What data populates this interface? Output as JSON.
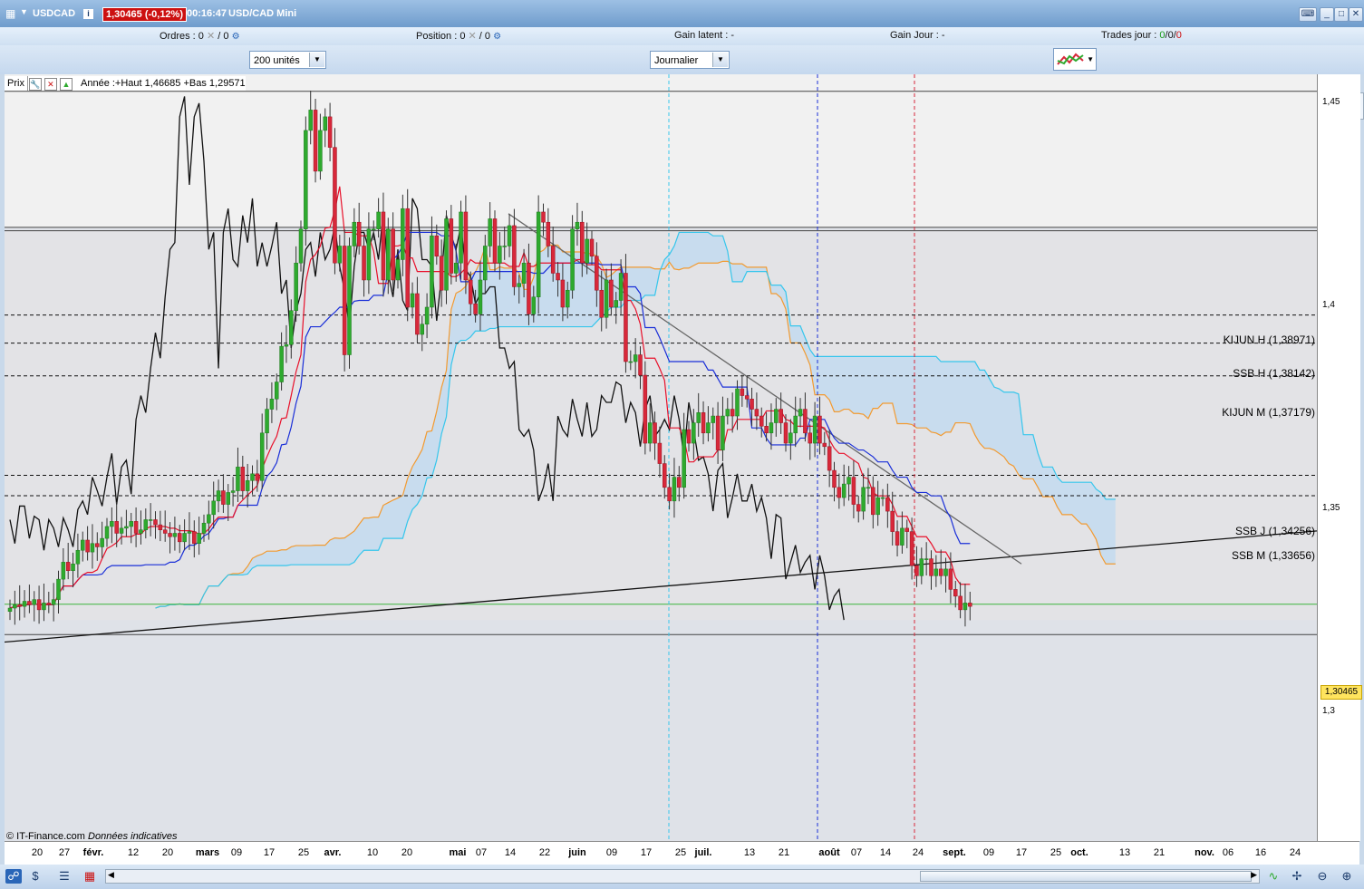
{
  "titlebar": {
    "symbol": "USDCAD",
    "price": "1,30465 (-0,12%)",
    "time": "00:16:47",
    "instrument": "USD/CAD Mini"
  },
  "infobar": {
    "orders_label": "Ordres :",
    "orders_value": "0",
    "orders_value2": "0",
    "position_label": "Position :",
    "position_value": "0",
    "position_value2": "0",
    "gain_latent_label": "Gain latent :",
    "gain_latent_value": "-",
    "gain_jour_label": "Gain Jour :",
    "gain_jour_value": "-",
    "trades_label": "Trades jour :",
    "trades_a": "0",
    "trades_b": "0",
    "trades_c": "0",
    "sep": "/"
  },
  "toolbar": {
    "units_select": "200 unités",
    "period_select": "Journalier"
  },
  "legend": {
    "prix": "Prix",
    "text": "Année :+Haut 1,46685 +Bas 1,29571"
  },
  "levels": [
    {
      "label": "KIJUN H (1,38971)",
      "value": 1.38971
    },
    {
      "label": "SSB H (1,38142)",
      "value": 1.38142
    },
    {
      "label": "KIJUN M (1,37179)",
      "value": 1.37179
    },
    {
      "label": "SSB J (1,34256)",
      "value": 1.34256
    },
    {
      "label": "SSB M (1,33656)",
      "value": 1.33656
    }
  ],
  "y_ticks": [
    "1,45",
    "1,4",
    "1,35",
    "1,3"
  ],
  "current_price": "1,30465",
  "x_ticks": [
    {
      "t": "20",
      "b": false
    },
    {
      "t": "27",
      "b": false
    },
    {
      "t": "févr.",
      "b": true
    },
    {
      "t": "12",
      "b": false
    },
    {
      "t": "20",
      "b": false
    },
    {
      "t": "mars",
      "b": true
    },
    {
      "t": "09",
      "b": false
    },
    {
      "t": "17",
      "b": false
    },
    {
      "t": "25",
      "b": false
    },
    {
      "t": "avr.",
      "b": true
    },
    {
      "t": "10",
      "b": false
    },
    {
      "t": "20",
      "b": false
    },
    {
      "t": "mai",
      "b": true
    },
    {
      "t": "07",
      "b": false
    },
    {
      "t": "14",
      "b": false
    },
    {
      "t": "22",
      "b": false
    },
    {
      "t": "juin",
      "b": true
    },
    {
      "t": "09",
      "b": false
    },
    {
      "t": "17",
      "b": false
    },
    {
      "t": "25",
      "b": false
    },
    {
      "t": "juil.",
      "b": true
    },
    {
      "t": "13",
      "b": false
    },
    {
      "t": "21",
      "b": false
    },
    {
      "t": "août",
      "b": true
    },
    {
      "t": "07",
      "b": false
    },
    {
      "t": "14",
      "b": false
    },
    {
      "t": "24",
      "b": false
    },
    {
      "t": "sept.",
      "b": true
    },
    {
      "t": "09",
      "b": false
    },
    {
      "t": "17",
      "b": false
    },
    {
      "t": "25",
      "b": false
    },
    {
      "t": "oct.",
      "b": true
    },
    {
      "t": "13",
      "b": false
    },
    {
      "t": "21",
      "b": false
    },
    {
      "t": "nov.",
      "b": true
    },
    {
      "t": "06",
      "b": false
    },
    {
      "t": "16",
      "b": false
    },
    {
      "t": "24",
      "b": false
    }
  ],
  "copyright": "© IT-Finance.com",
  "copyright_note": "Données indicatives",
  "colors": {
    "bull": "#2eaa2e",
    "bear": "#d8283a",
    "tenkan": "#e8102a",
    "kijun": "#1a2fd8",
    "chikou": "#111111",
    "ssa": "#f29a30",
    "ssb": "#36c6ec",
    "cloud": "#bfd9f0"
  },
  "chart_data": {
    "type": "candlestick",
    "y_range": [
      1.235,
      1.4605
    ],
    "year_high": 1.46685,
    "year_low": 1.29571,
    "last": 1.30465,
    "closes": [
      1.3035,
      1.3045,
      1.304,
      1.3055,
      1.3045,
      1.306,
      1.303,
      1.305,
      1.3045,
      1.306,
      1.312,
      1.317,
      1.3145,
      1.3165,
      1.3205,
      1.3235,
      1.32,
      1.3225,
      1.3215,
      1.324,
      1.3275,
      1.329,
      1.3255,
      1.327,
      1.3275,
      1.329,
      1.3255,
      1.3265,
      1.3295,
      1.3295,
      1.328,
      1.3265,
      1.3255,
      1.3245,
      1.3255,
      1.323,
      1.3255,
      1.326,
      1.3225,
      1.3255,
      1.3285,
      1.331,
      1.335,
      1.338,
      1.334,
      1.3375,
      1.338,
      1.345,
      1.338,
      1.341,
      1.343,
      1.341,
      1.355,
      1.362,
      1.365,
      1.37,
      1.3805,
      1.381,
      1.391,
      1.405,
      1.415,
      1.444,
      1.45,
      1.432,
      1.444,
      1.448,
      1.439,
      1.405,
      1.41,
      1.378,
      1.41,
      1.417,
      1.41,
      1.4,
      1.415,
      1.415,
      1.42,
      1.4,
      1.415,
      1.4,
      1.406,
      1.421,
      1.392,
      1.396,
      1.384,
      1.387,
      1.392,
      1.413,
      1.407,
      1.397,
      1.418,
      1.402,
      1.405,
      1.42,
      1.4,
      1.393,
      1.39,
      1.4,
      1.41,
      1.418,
      1.405,
      1.41,
      1.41,
      1.416,
      1.398,
      1.399,
      1.405,
      1.39,
      1.395,
      1.42,
      1.417,
      1.41,
      1.402,
      1.4,
      1.392,
      1.397,
      1.415,
      1.417,
      1.405,
      1.412,
      1.407,
      1.397,
      1.389,
      1.4,
      1.392,
      1.394,
      1.402,
      1.376,
      1.376,
      1.378,
      1.372,
      1.352,
      1.358,
      1.352,
      1.346,
      1.339,
      1.335,
      1.342,
      1.339,
      1.356,
      1.352,
      1.358,
      1.361,
      1.355,
      1.358,
      1.36,
      1.35,
      1.36,
      1.362,
      1.36,
      1.368,
      1.366,
      1.365,
      1.362,
      1.36,
      1.357,
      1.355,
      1.358,
      1.362,
      1.358,
      1.352,
      1.355,
      1.36,
      1.362,
      1.355,
      1.352,
      1.36,
      1.352,
      1.351,
      1.344,
      1.339,
      1.336,
      1.34,
      1.342,
      1.334,
      1.332,
      1.339,
      1.339,
      1.331,
      1.336,
      1.336,
      1.332,
      1.326,
      1.322,
      1.327,
      1.326,
      1.316,
      1.313,
      1.318,
      1.318,
      1.313,
      1.315,
      1.313,
      1.315,
      1.309,
      1.307,
      1.303,
      1.305,
      1.304
    ]
  }
}
